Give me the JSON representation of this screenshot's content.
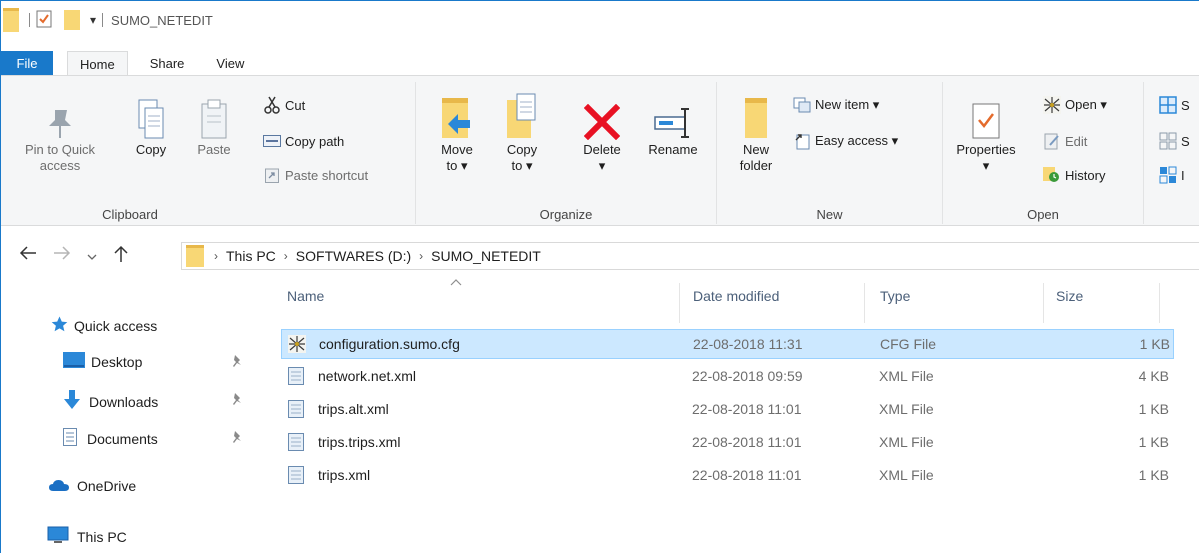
{
  "window": {
    "title": "SUMO_NETEDIT",
    "qat_dropdown": "▾"
  },
  "ribbon_tabs": [
    "File",
    "Home",
    "Share",
    "View"
  ],
  "ribbon": {
    "clipboard": {
      "label": "Clipboard",
      "pin_line1": "Pin to Quick",
      "pin_line2": "access",
      "copy": "Copy",
      "paste": "Paste",
      "cut": "Cut",
      "copy_path": "Copy path",
      "paste_shortcut": "Paste shortcut"
    },
    "organize": {
      "label": "Organize",
      "move_line1": "Move",
      "move_line2": "to ▾",
      "copy_line1": "Copy",
      "copy_line2": "to ▾",
      "delete": "Delete",
      "delete_arrow": "▾",
      "rename": "Rename"
    },
    "new": {
      "label": "New",
      "new_item": "New item ▾",
      "easy_access": "Easy access ▾",
      "new_folder_line1": "New",
      "new_folder_line2": "folder"
    },
    "open": {
      "label": "Open",
      "properties": "Properties",
      "properties_arrow": "▾",
      "open": "Open ▾",
      "edit": "Edit",
      "history": "History"
    },
    "select": {
      "item1": "S",
      "item2": "S",
      "item3": "I"
    }
  },
  "address": {
    "breadcrumbs": [
      "This PC",
      "SOFTWARES (D:)",
      "SUMO_NETEDIT"
    ]
  },
  "navpane": {
    "quick_access": "Quick access",
    "desktop": "Desktop",
    "downloads": "Downloads",
    "documents": "Documents",
    "onedrive": "OneDrive",
    "this_pc": "This PC"
  },
  "columns": {
    "name": "Name",
    "date": "Date modified",
    "type": "Type",
    "size": "Size"
  },
  "files": [
    {
      "name": "configuration.sumo.cfg",
      "date": "22-08-2018 11:31",
      "type": "CFG File",
      "size": "1 KB",
      "selected": true
    },
    {
      "name": "network.net.xml",
      "date": "22-08-2018 09:59",
      "type": "XML File",
      "size": "4 KB",
      "selected": false
    },
    {
      "name": "trips.alt.xml",
      "date": "22-08-2018 11:01",
      "type": "XML File",
      "size": "1 KB",
      "selected": false
    },
    {
      "name": "trips.trips.xml",
      "date": "22-08-2018 11:01",
      "type": "XML File",
      "size": "1 KB",
      "selected": false
    },
    {
      "name": "trips.xml",
      "date": "22-08-2018 11:01",
      "type": "XML File",
      "size": "1 KB",
      "selected": false
    }
  ],
  "colors": {
    "accent": "#1979ca",
    "selection": "#cce8ff",
    "folder": "#f8d775",
    "delete_red": "#e81123"
  }
}
